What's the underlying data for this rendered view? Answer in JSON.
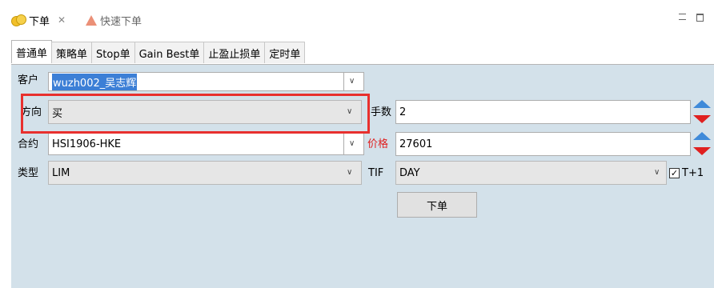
{
  "view_tabs": {
    "active_label": "下单",
    "inactive_label": "快速下单"
  },
  "order_tabs": [
    "普通单",
    "策略单",
    "Stop单",
    "Gain Best单",
    "止盈止损单",
    "定时单"
  ],
  "form": {
    "client_label": "客户",
    "client_value": "wuzh002_吴志辉",
    "direction_label": "方向",
    "direction_value": "买",
    "lots_label": "手数",
    "lots_value": "2",
    "contract_label": "合约",
    "contract_value": "HSI1906-HKE",
    "price_label": "价格",
    "price_value": "27601",
    "type_label": "类型",
    "type_value": "LIM",
    "tif_label": "TIF",
    "tif_value": "DAY",
    "t1_label": "T+1",
    "t1_checked": true,
    "submit_label": "下单"
  },
  "colors": {
    "panel_bg": "#d3e1ea",
    "selection": "#3c7fd6",
    "annotation": "#e8302e",
    "price_label": "#e02020",
    "spin_up": "#3f8ad9",
    "spin_down": "#e02020"
  }
}
